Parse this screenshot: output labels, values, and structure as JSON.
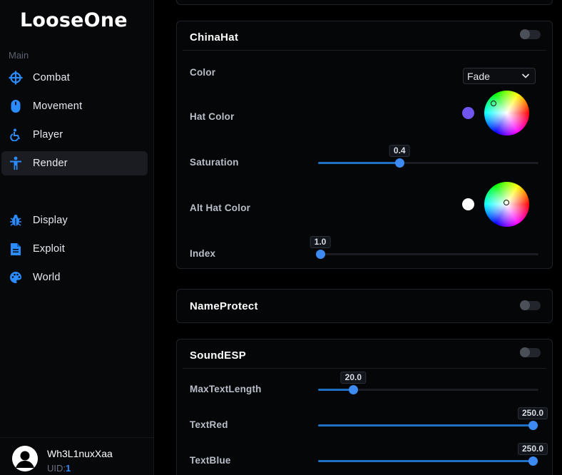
{
  "app": {
    "name": "LooseOne"
  },
  "sidebar": {
    "section_label": "Main",
    "items": [
      {
        "label": "Combat",
        "icon": "crosshair-icon"
      },
      {
        "label": "Movement",
        "icon": "mouse-icon"
      },
      {
        "label": "Player",
        "icon": "wheelchair-icon"
      },
      {
        "label": "Render",
        "icon": "person-icon",
        "active": true
      },
      {
        "label": "Display",
        "icon": "bug-icon"
      },
      {
        "label": "Exploit",
        "icon": "file-icon"
      },
      {
        "label": "World",
        "icon": "palette-icon"
      }
    ],
    "user": {
      "name": "Wh3L1nuxXaa",
      "uid_label": "UID:",
      "uid_value": "1"
    }
  },
  "modules": {
    "chinahat": {
      "title": "ChinaHat",
      "enabled": false,
      "color": {
        "label": "Color",
        "value": "Fade"
      },
      "hat_color": {
        "label": "Hat Color",
        "swatch": "#7155f0"
      },
      "saturation": {
        "label": "Saturation",
        "value": "0.4",
        "fraction": 0.36
      },
      "alt_hat_color": {
        "label": "Alt Hat Color",
        "swatch": "#ffffff"
      },
      "index": {
        "label": "Index",
        "value": "1.0",
        "fraction": 0.0
      }
    },
    "nameprotect": {
      "title": "NameProtect",
      "enabled": false
    },
    "soundesp": {
      "title": "SoundESP",
      "enabled": false,
      "max_text_length": {
        "label": "MaxTextLength",
        "value": "20.0",
        "fraction": 0.15
      },
      "text_red": {
        "label": "TextRed",
        "value": "250.0",
        "fraction": 0.98
      },
      "text_blue": {
        "label": "TextBlue",
        "value": "250.0",
        "fraction": 0.98
      }
    }
  },
  "colors": {
    "accent": "#3d8bf2",
    "accent_dark": "#1f6fc4",
    "uid": "#2b8cff"
  }
}
